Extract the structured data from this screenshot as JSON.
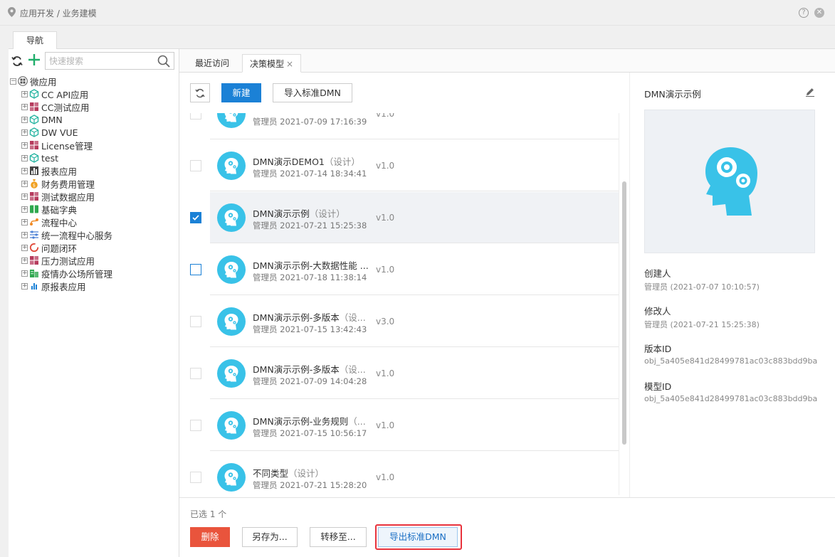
{
  "header": {
    "breadcrumb": "应用开发 / 业务建模",
    "help_icon": "question-circle-icon",
    "close_icon": "close-circle-icon"
  },
  "nav": {
    "tab_label": "导航",
    "search_placeholder": "快速搜索",
    "root": {
      "label": "微应用",
      "icon": "app-grid-icon"
    },
    "items": [
      {
        "label": "CC API应用",
        "icon": "cube-icon",
        "color": "#25b4a1"
      },
      {
        "label": "CC测试应用",
        "icon": "blocks-icon",
        "color": "#b63b5d"
      },
      {
        "label": "DMN",
        "icon": "cube-icon",
        "color": "#25b4a1"
      },
      {
        "label": "DW VUE",
        "icon": "cube-icon",
        "color": "#25b4a1"
      },
      {
        "label": "License管理",
        "icon": "blocks-icon",
        "color": "#b63b5d"
      },
      {
        "label": "test",
        "icon": "cube-icon",
        "color": "#25b4a1"
      },
      {
        "label": "报表应用",
        "icon": "bar-chart-icon",
        "color": "#444444"
      },
      {
        "label": "财务费用管理",
        "icon": "money-bag-icon",
        "color": "#f0a020"
      },
      {
        "label": "测试数据应用",
        "icon": "blocks-icon",
        "color": "#b63b5d"
      },
      {
        "label": "基础字典",
        "icon": "book-icon",
        "color": "#2fa84f"
      },
      {
        "label": "流程中心",
        "icon": "flow-icon",
        "color": "#f08a24"
      },
      {
        "label": "统一流程中心服务",
        "icon": "sliders-icon",
        "color": "#4a7fd4"
      },
      {
        "label": "问题闭环",
        "icon": "loop-icon",
        "color": "#e04a3a"
      },
      {
        "label": "压力测试应用",
        "icon": "blocks-icon",
        "color": "#b63b5d"
      },
      {
        "label": "疫情办公场所管理",
        "icon": "building-icon",
        "color": "#2fa84f"
      },
      {
        "label": "原报表应用",
        "icon": "bar-chart-icon",
        "color": "#1b81d6"
      }
    ]
  },
  "tabs": [
    {
      "label": "最近访问"
    },
    {
      "label": "决策模型",
      "close": "×"
    }
  ],
  "toolbar": {
    "new_label": "新建",
    "import_label": "导入标准DMN"
  },
  "models": [
    {
      "name": "",
      "tag": "",
      "meta": "管理员 2021-07-09 17:16:39",
      "version": "v1.0",
      "state": "none"
    },
    {
      "name": "DMN演示DEMO1",
      "tag": "（设计）",
      "meta": "管理员 2021-07-14 18:34:41",
      "version": "v1.0",
      "state": "none"
    },
    {
      "name": "DMN演示示例",
      "tag": "（设计）",
      "meta": "管理员 2021-07-21 15:25:38",
      "version": "v1.0",
      "state": "checked"
    },
    {
      "name": "DMN演示示例-大数据性能 ...",
      "tag": "",
      "meta": "管理员 2021-07-18 11:38:14",
      "version": "v1.0",
      "state": "hover"
    },
    {
      "name": "DMN演示示例-多版本",
      "tag": "（设...",
      "meta": "管理员 2021-07-15 13:42:43",
      "version": "v3.0",
      "state": "none"
    },
    {
      "name": "DMN演示示例-多版本",
      "tag": "（设...",
      "meta": "管理员 2021-07-09 14:04:28",
      "version": "v1.0",
      "state": "none"
    },
    {
      "name": "DMN演示示例-业务规则",
      "tag": "（...",
      "meta": "管理员 2021-07-15 10:56:17",
      "version": "v1.0",
      "state": "none"
    },
    {
      "name": "不同类型",
      "tag": "（设计）",
      "meta": "管理员 2021-07-21 15:28:20",
      "version": "v1.0",
      "state": "none"
    }
  ],
  "bottom": {
    "selected_text": "已选 1 个",
    "delete_label": "删除",
    "saveas_label": "另存为...",
    "move_label": "转移至...",
    "export_label": "导出标准DMN"
  },
  "detail": {
    "title": "DMN演示示例",
    "creator_label": "创建人",
    "creator_value": "管理员 (2021-07-07 10:10:57)",
    "modifier_label": "修改人",
    "modifier_value": "管理员 (2021-07-21 15:25:38)",
    "version_id_label": "版本ID",
    "version_id_value": "obj_5a405e841d28499781ac03c883bdd9ba",
    "model_id_label": "模型ID",
    "model_id_value": "obj_5a405e841d28499781ac03c883bdd9ba"
  },
  "colors": {
    "primary": "#1b81d6",
    "danger": "#e9543c",
    "avatar": "#39c2e8",
    "highlight": "#e8323c"
  }
}
